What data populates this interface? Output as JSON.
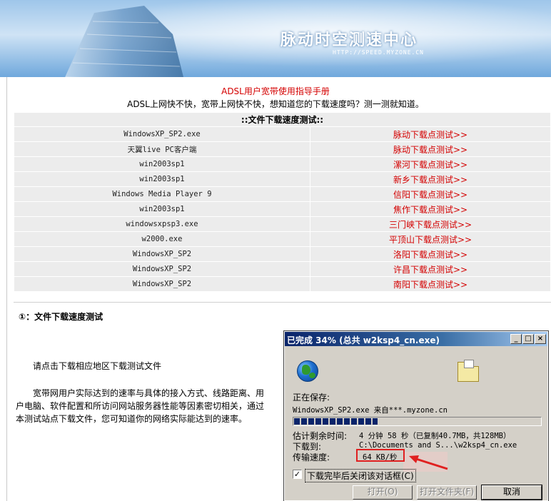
{
  "banner": {
    "brand_title": "脉动时空测速中心",
    "brand_url": "HTTP://SPEED.MYZONE.CN"
  },
  "header": {
    "guide_title": "ADSL用户宽带使用指导手册",
    "subtitle": "ADSL上网快不快，宽带上网快不快，想知道您的下载速度吗？测一测就知道。"
  },
  "table": {
    "heading": "::文件下载速度测试::",
    "rows": [
      {
        "file": "WindowsXP_SP2.exe",
        "link": "脉动下载点测试>>"
      },
      {
        "file": "天翼live PC客户端",
        "link": "脉动下载点测试>>"
      },
      {
        "file": "win2003sp1",
        "link": "漯河下载点测试>>"
      },
      {
        "file": "win2003sp1",
        "link": "新乡下载点测试>>"
      },
      {
        "file": "Windows Media Player 9",
        "link": "信阳下载点测试>>"
      },
      {
        "file": "win2003sp1",
        "link": "焦作下载点测试>>"
      },
      {
        "file": "windowsxpsp3.exe",
        "link": "三门峡下载点测试>>"
      },
      {
        "file": "w2000.exe",
        "link": "平顶山下载点测试>>"
      },
      {
        "file": "WindowsXP_SP2",
        "link": "洛阳下载点测试>>"
      },
      {
        "file": "WindowsXP_SP2",
        "link": "许昌下载点测试>>"
      },
      {
        "file": "WindowsXP_SP2",
        "link": "南阳下载点测试>>"
      }
    ]
  },
  "section": {
    "title": "①：文件下载速度测试",
    "para1": "请点击下载相应地区下载测试文件",
    "para2": "宽带网用户实际达到的速率与具体的接入方式、线路距离、用户电脑、软件配置和所访问网站服务器性能等因素密切相关，通过本测试站点下载文件，您可知道你的网络实际能达到的速率。"
  },
  "dialog": {
    "title": "已完成 34% (总共 w2ksp4_cn.exe)",
    "saving_label": "正在保存:",
    "saving_value": "WindowsXP_SP2.exe 来自***.myzone.cn",
    "progress": 0.34,
    "eta_label": "估计剩余时间:",
    "eta_value": "4 分钟 58 秒（已复制40.7MB，共128MB）",
    "dest_label": "下载到:",
    "dest_value": "C:\\Documents and S...\\w2ksp4_cn.exe",
    "rate_label": "传输速度:",
    "rate_value": "64 KB/秒",
    "close_checkbox_label": "下载完毕后关闭该对话框(C)",
    "close_checked": true,
    "btn_open": "打开(O)",
    "btn_open_folder": "打开文件夹(F)",
    "btn_cancel": "取消",
    "tb_min": "_",
    "tb_max": "□",
    "tb_close": "×"
  },
  "colors": {
    "link_red": "#d40000",
    "titlebar_start": "#0a246a",
    "dialog_bg": "#d4d0c8"
  }
}
